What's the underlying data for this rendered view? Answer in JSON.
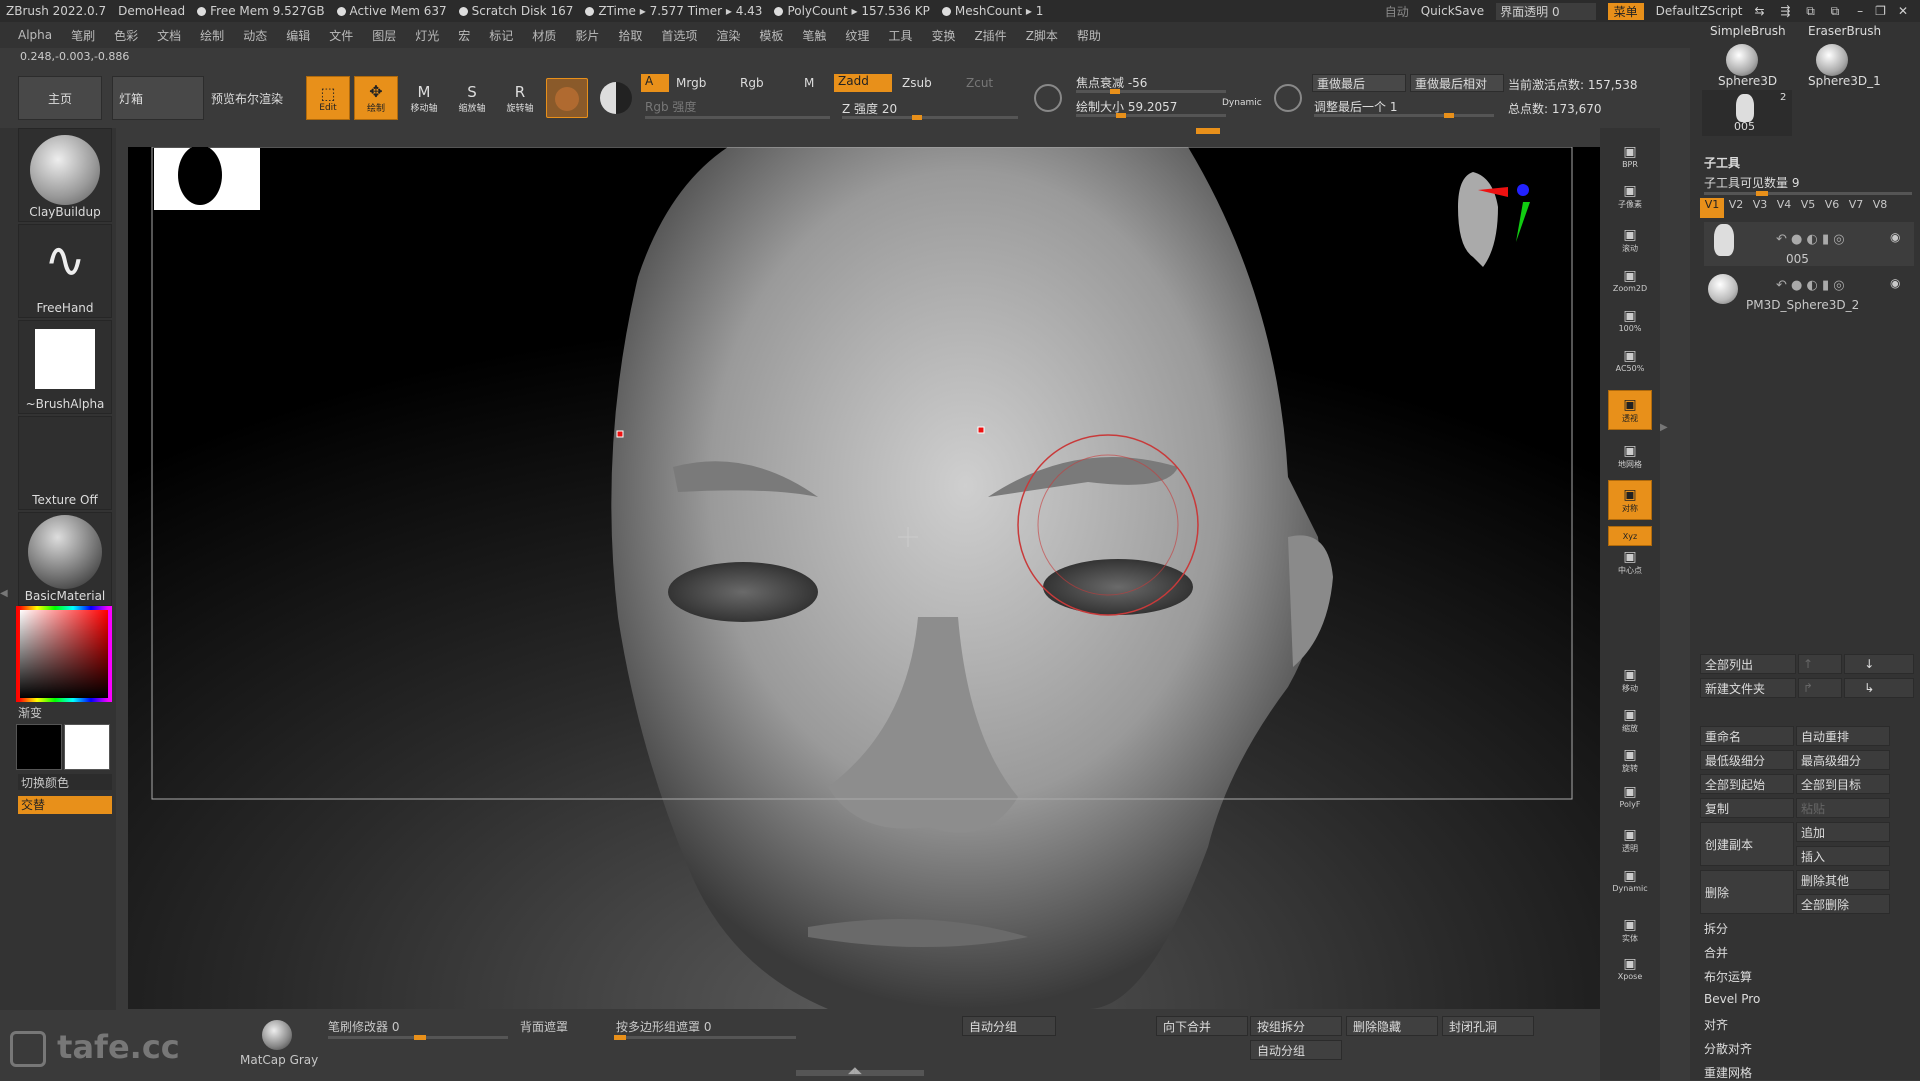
{
  "titlebar": {
    "app": "ZBrush 2022.0.7",
    "project": "DemoHead",
    "free_mem": "Free Mem 9.527GB",
    "active_mem": "Active Mem 637",
    "scratch": "Scratch Disk 167",
    "ztime": "ZTime ▸ 7.577 Timer ▸ 4.43",
    "polycount": "PolyCount ▸ 157.536 KP",
    "meshcount": "MeshCount ▸ 1",
    "auto": "自动",
    "quicksave": "QuickSave",
    "transparency": "界面透明 0",
    "menu": "菜单",
    "script": "DefaultZScript"
  },
  "menubar": [
    "Alpha",
    "笔刷",
    "色彩",
    "文档",
    "绘制",
    "动态",
    "编辑",
    "文件",
    "图层",
    "灯光",
    "宏",
    "标记",
    "材质",
    "影片",
    "拾取",
    "首选项",
    "渲染",
    "模板",
    "笔触",
    "纹理",
    "工具",
    "变换",
    "Z插件",
    "Z脚本",
    "帮助"
  ],
  "coords": "0.248,-0.003,-0.886",
  "toolbar": {
    "home": "主页",
    "lightbox": "灯箱",
    "bpr_preview": "预览布尔渲染",
    "edit": "Edit",
    "draw": "绘制",
    "move": "移动轴",
    "scale": "缩放轴",
    "rotate": "旋转轴",
    "a": "A",
    "mrgb": "Mrgb",
    "rgb": "Rgb",
    "m": "M",
    "rgb_intensity": "Rgb 强度",
    "zadd": "Zadd",
    "zsub": "Zsub",
    "zcut": "Zcut",
    "z_intensity": "Z 强度 20",
    "focal_shift": "焦点衰减 -56",
    "draw_size": "绘制大小 59.2057",
    "dynamic": "Dynamic",
    "replay_last": "重做最后",
    "replay_last_rel": "重做最后相对",
    "adjust_last": "调整最后一个 1",
    "active_points": "当前激活点数: 157,538",
    "total_points": "总点数: 173,670"
  },
  "left": {
    "brush": "ClayBuildup",
    "stroke": "FreeHand",
    "alpha": "~BrushAlpha",
    "texture": "Texture Off",
    "material": "BasicMaterial",
    "gradient": "渐变",
    "switch_color": "切换颜色",
    "alternate": "交替"
  },
  "right_buttons": [
    "BPR",
    "子像素",
    "滚动",
    "Zoom2D",
    "100%",
    "AC50%",
    "透视",
    "地网格",
    "对称",
    "Xyz",
    "中心点",
    "移动",
    "缩放",
    "旋转",
    "PolyF",
    "透明",
    "Dynamic",
    "实体",
    "Xpose"
  ],
  "toolpanel": {
    "simple_brush": "SimpleBrush",
    "eraser_brush": "EraserBrush",
    "sphere3d": "Sphere3D",
    "sphere3d_1": "Sphere3D_1",
    "count": "2",
    "tool_005": "005",
    "subtool_title": "子工具",
    "visible_count": "子工具可见数量 9",
    "versions": [
      "V1",
      "V2",
      "V3",
      "V4",
      "V5",
      "V6",
      "V7",
      "V8"
    ],
    "subtool1": "005",
    "subtool2": "PM3D_Sphere3D_2",
    "list_all": "全部列出",
    "new_folder": "新建文件夹",
    "rename": "重命名",
    "auto_reorder": "自动重排",
    "lowest_subdiv": "最低级细分",
    "highest_subdiv": "最高级细分",
    "all_to_start": "全部到起始",
    "all_to_target": "全部到目标",
    "duplicate": "复制",
    "paste": "粘贴",
    "append": "追加",
    "create_copy": "创建副本",
    "insert": "插入",
    "delete": "删除",
    "delete_others": "删除其他",
    "delete_all": "全部删除",
    "split": "拆分",
    "merge": "合并",
    "boolean": "布尔运算",
    "bevel_pro": "Bevel Pro",
    "align": "对齐",
    "distribute": "分散对齐",
    "remesh": "重建网格"
  },
  "bottom": {
    "matcap": "MatCap Gray",
    "brush_modifier": "笔刷修改器 0",
    "backface": "背面遮罩",
    "polygroup_mask": "按多边形组遮罩 0",
    "auto_group": "自动分组",
    "merge_down": "向下合并",
    "group_split": "按组拆分",
    "delete_hidden": "删除隐藏",
    "close_holes": "封闭孔洞",
    "auto_group2": "自动分组",
    "watermark": "tafe.cc"
  },
  "colors": {
    "accent": "#e8901a",
    "bg": "#3a3a3a",
    "dark": "#2b2b2b"
  }
}
